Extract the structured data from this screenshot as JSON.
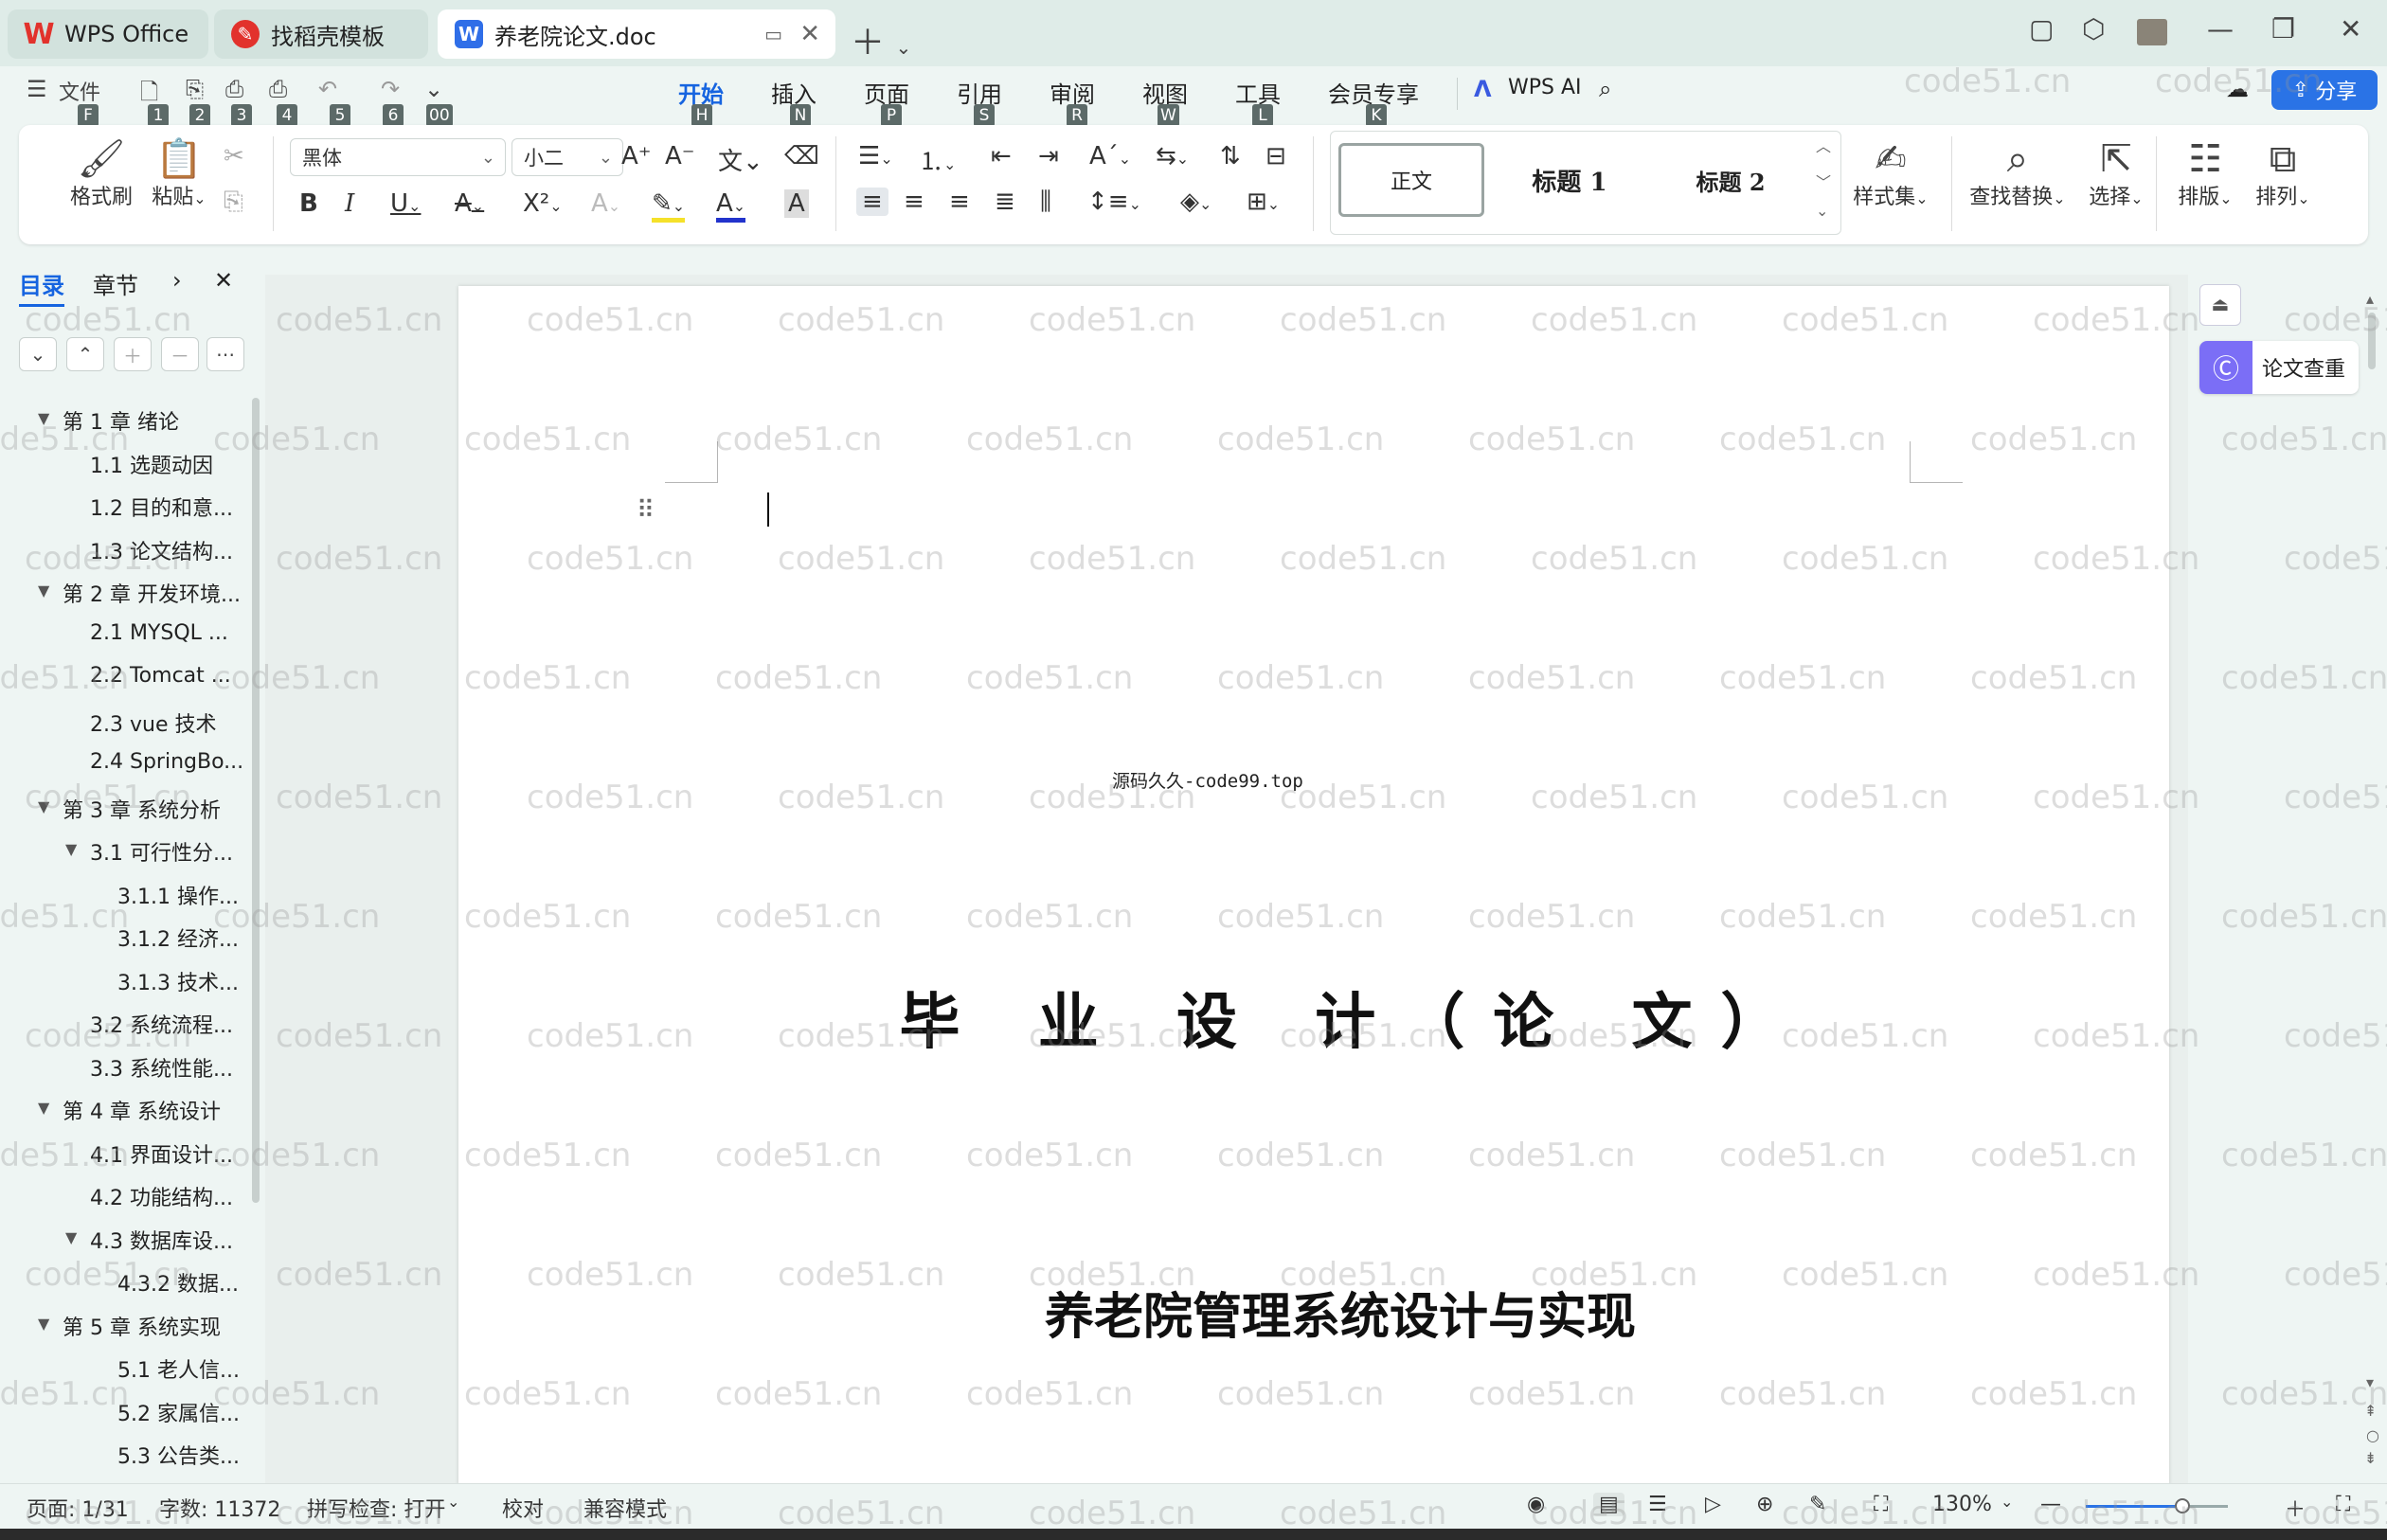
{
  "titlebar": {
    "tabs": [
      {
        "label": "WPS Office"
      },
      {
        "label": "找稻壳模板"
      },
      {
        "label": "养老院论文.doc"
      }
    ]
  },
  "menu": {
    "file_label": "文件",
    "tabs": [
      {
        "label": "开始",
        "key": "H"
      },
      {
        "label": "插入",
        "key": "N"
      },
      {
        "label": "页面",
        "key": "P"
      },
      {
        "label": "引用",
        "key": "S"
      },
      {
        "label": "审阅",
        "key": "R"
      },
      {
        "label": "视图",
        "key": "W"
      },
      {
        "label": "工具",
        "key": "L"
      },
      {
        "label": "会员专享",
        "key": "K"
      }
    ],
    "wps_ai": "WPS AI",
    "share": "分享",
    "qat_keys": [
      "F",
      "1",
      "2",
      "3",
      "4",
      "5",
      "6",
      "00"
    ]
  },
  "ribbon": {
    "format_painter": "格式刷",
    "paste": "粘贴",
    "font_name": "黑体",
    "font_size": "小二",
    "styles": [
      "正文",
      "标题 1",
      "标题 2"
    ],
    "style_set": "样式集",
    "find_replace": "查找替换",
    "select": "选择",
    "typeset": "排版",
    "arrange": "排列"
  },
  "sidebar": {
    "tabs": [
      "目录",
      "章节"
    ],
    "toc": [
      {
        "text": "第 1 章  绪论",
        "level": 1
      },
      {
        "text": "1.1 选题动因",
        "level": 2
      },
      {
        "text": "1.2 目的和意...",
        "level": 2
      },
      {
        "text": "1.3 论文结构...",
        "level": 2
      },
      {
        "text": "第 2 章  开发环境...",
        "level": 1
      },
      {
        "text": "2.1 MYSQL ...",
        "level": 2
      },
      {
        "text": "2.2 Tomcat ...",
        "level": 2
      },
      {
        "text": "2.3 vue 技术",
        "level": 2
      },
      {
        "text": "2.4 SpringBo...",
        "level": 2
      },
      {
        "text": "第 3 章  系统分析",
        "level": 1
      },
      {
        "text": "3.1 可行性分...",
        "level": 2
      },
      {
        "text": "3.1.1 操作...",
        "level": 3
      },
      {
        "text": "3.1.2 经济...",
        "level": 3
      },
      {
        "text": "3.1.3 技术...",
        "level": 3
      },
      {
        "text": "3.2 系统流程...",
        "level": 2
      },
      {
        "text": "3.3 系统性能...",
        "level": 2
      },
      {
        "text": "第 4 章  系统设计",
        "level": 1
      },
      {
        "text": "4.1 界面设计...",
        "level": 2
      },
      {
        "text": "4.2 功能结构...",
        "level": 2
      },
      {
        "text": "4.3 数据库设...",
        "level": 2
      },
      {
        "text": "4.3.2  数据...",
        "level": 3
      },
      {
        "text": "第 5 章  系统实现",
        "level": 1
      },
      {
        "text": "5.1 老人信...",
        "level": 3
      },
      {
        "text": "5.2  家属信...",
        "level": 3
      },
      {
        "text": "5.3 公告类...",
        "level": 3
      }
    ]
  },
  "document": {
    "subtitle": "源码久久-code99.top",
    "title": "毕 业 设 计（论 文）",
    "main_title": "养老院管理系统设计与实现"
  },
  "right_panel": {
    "paper_check": "论文查重"
  },
  "status": {
    "page": "页面: 1/31",
    "words": "字数: 11372",
    "spell": "拼写检查: 打开",
    "proof": "校对",
    "compat": "兼容模式",
    "zoom": "130%"
  },
  "watermark_text": "code51.cn"
}
